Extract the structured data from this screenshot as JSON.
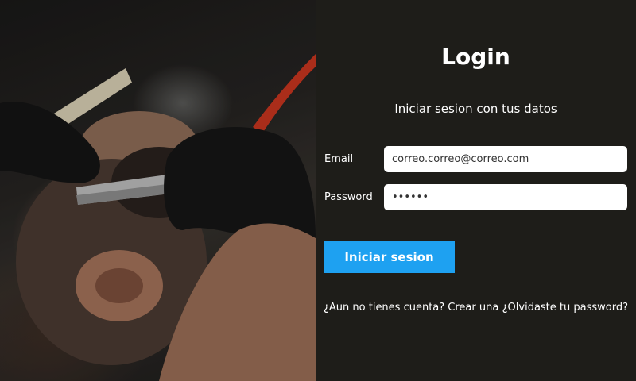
{
  "login": {
    "title": "Login",
    "subtitle": "Iniciar sesion con tus datos",
    "email_label": "Email",
    "email_value": "correo.correo@correo.com",
    "password_label": "Password",
    "password_value": "••••••",
    "submit_label": "Iniciar sesion",
    "register_link": "¿Aun no tienes cuenta? Crear una",
    "forgot_link": "¿Olvidaste tu password?"
  },
  "colors": {
    "panel_bg": "#1e1d19",
    "button_bg": "#1ea1f1",
    "text": "#ffffff"
  }
}
